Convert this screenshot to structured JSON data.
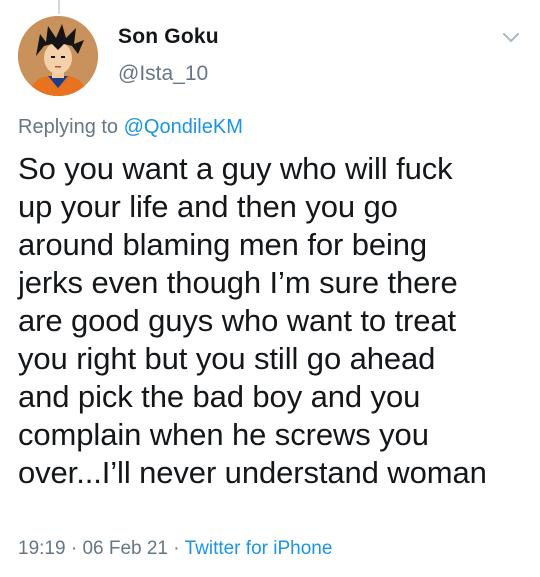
{
  "author": {
    "name": "Son Goku",
    "handle": "@Ista_10",
    "avatar_icon": "goku-avatar-icon"
  },
  "reply": {
    "prefix": "Replying to ",
    "mention": "@QondileKM"
  },
  "tweet": {
    "text": "So you want a guy who will fuck\nup your life and then you go\naround blaming men for being\njerks even though I’m sure there\nare good guys who want to treat\nyou right but you still go ahead\nand pick the bad boy and you\ncomplain when he screws you\nover...I’ll never understand woman"
  },
  "meta": {
    "time": "19:19",
    "sep1": " · ",
    "date": "06 Feb 21",
    "sep2": " · ",
    "source": "Twitter for iPhone"
  },
  "colors": {
    "link": "#1b95e0",
    "muted": "#657786",
    "text": "#14171a"
  }
}
